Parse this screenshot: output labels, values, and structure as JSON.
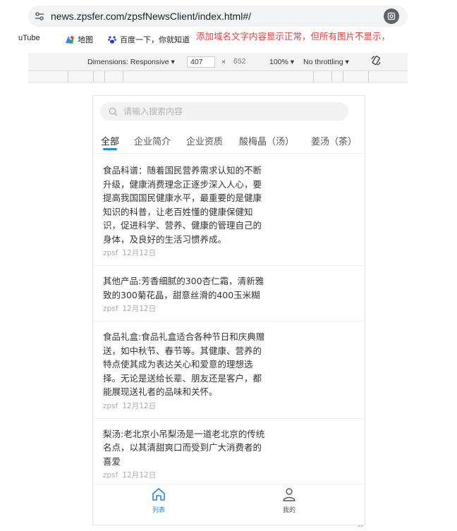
{
  "browser": {
    "url": "news.zpsfer.com/zpsfNewsClient/index.html#/",
    "bookmarks": [
      "uTube",
      "地图",
      "百度一下，你就知道"
    ]
  },
  "annotation": "添加域名文字内容显示正常，但所有图片不显示，",
  "devtools": {
    "dimensions_label": "Dimensions: Responsive ▾",
    "width": "407",
    "times": "×",
    "height": "652",
    "zoom": "100% ▾",
    "throttling": "No throttling ▾"
  },
  "app": {
    "search_placeholder": "请输入搜索内容",
    "tabs": [
      "全部",
      "企业简介",
      "企业资质",
      "酸梅晶（汤）",
      "姜汤（茶）"
    ],
    "items": [
      {
        "text": "食品科谱：随着国民营养需求认知的不断升级，健康消费理念正逐步深入人心，要提高我国国民健康水平，最重要的是健康知识的科普，让老百姓懂的健康保健知识，促进科学、营养、健康的管理自己的身体，及良好的生活习惯养成。",
        "author": "zpsf",
        "date": "12月12日"
      },
      {
        "text": "其他产品:芳香细腻的300杏仁霜，清新雅致的300菊花晶，甜意丝滑的400玉米糊",
        "author": "zpsf",
        "date": "12月12日"
      },
      {
        "text": "食品礼盒:食品礼盒适合各种节日和庆典赠送，如中秋节、春节等。其健康、营养的特点使其成为表达关心和爱意的理想选择。无论是送给长辈、朋友还是客户，都能展现送礼者的品味和关怀。",
        "author": "zpsf",
        "date": "12月12日"
      },
      {
        "text": "梨汤:老北京小吊梨汤是一道老北京的传统名点，以其清甜爽口而受到广大消费者的喜爱",
        "author": "zpsf",
        "date": "12月12日"
      }
    ],
    "tabbar": {
      "home_label": "列表",
      "me_label": "我的"
    }
  },
  "colors": {
    "accent": "#1e88e5",
    "annotation": "#e53935"
  }
}
